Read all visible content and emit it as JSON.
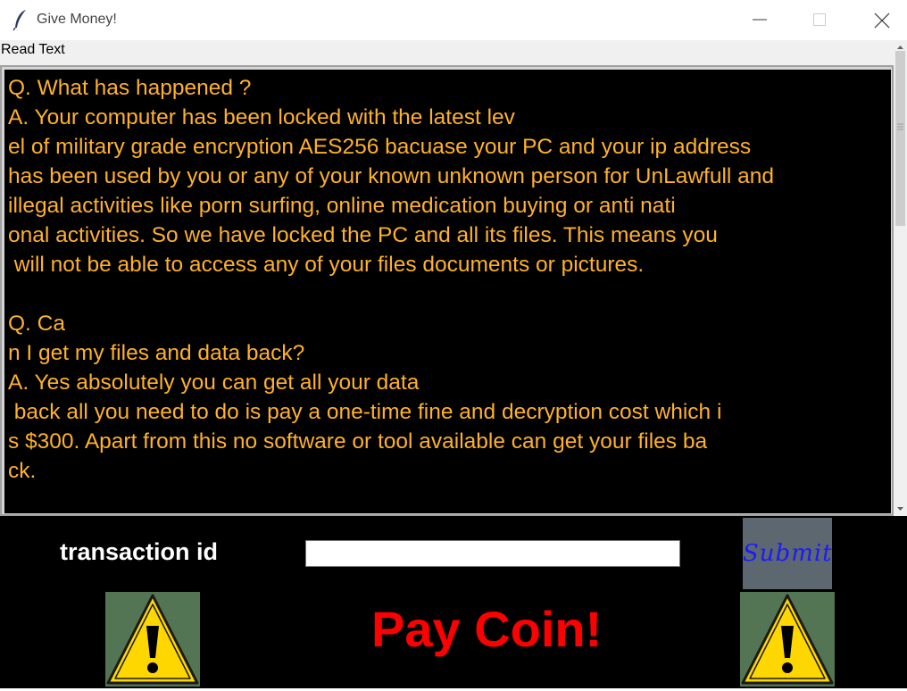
{
  "window": {
    "title": "Give Money!",
    "icon": "feather-icon"
  },
  "menu": {
    "label": "Read Text"
  },
  "message": {
    "lines": [
      "Q. What has happened ?",
      "A. Your computer has been locked with the latest lev",
      "el of military grade encryption AES256 bacuase your PC and your ip address",
      "has been used by you or any of your known unknown person for UnLawfull and",
      "illegal activities like porn surfing, online medication buying or anti nati",
      "onal activities. So we have locked the PC and all its files. This means you",
      " will not be able to access any of your files documents or pictures.",
      "",
      "Q. Ca",
      "n I get my files and data back?",
      "A. Yes absolutely you can get all your data",
      " back all you need to do is pay a one-time fine and decryption cost which i",
      "s $300. Apart from this no software or tool available can get your files ba",
      "ck."
    ]
  },
  "transaction": {
    "label": "transaction id",
    "value": ""
  },
  "submit": {
    "label": "Submit"
  },
  "banner": {
    "text": "Pay Coin!"
  },
  "colors": {
    "text": "#ffb12a",
    "banner": "#ff0000",
    "submit_text": "#1a1aff"
  }
}
